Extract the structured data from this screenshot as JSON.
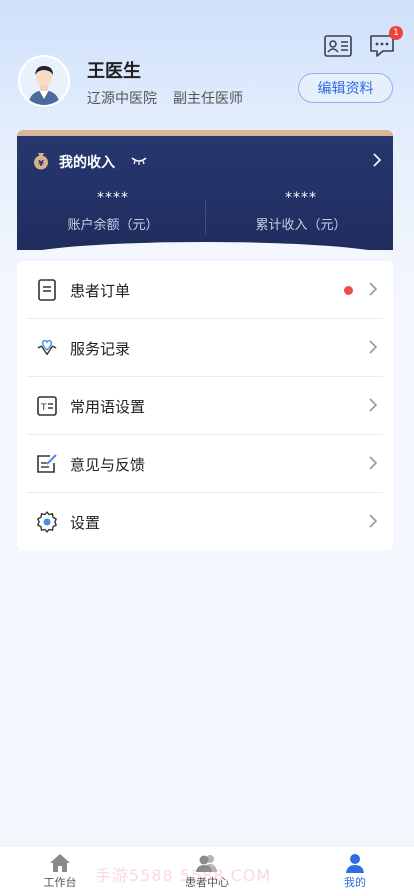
{
  "header": {
    "id_card_icon": "id-card-icon",
    "message_icon": "message-icon",
    "message_badge": "1"
  },
  "profile": {
    "name": "王医生",
    "hospital": "辽源中医院",
    "title": "副主任医师",
    "edit_label": "编辑资料"
  },
  "income": {
    "title": "我的收入",
    "balance_value": "****",
    "balance_label": "账户余额（元）",
    "total_value": "****",
    "total_label": "累计收入（元）"
  },
  "menu": [
    {
      "label": "患者订单",
      "icon": "order-icon",
      "dot": true
    },
    {
      "label": "服务记录",
      "icon": "service-icon",
      "dot": false
    },
    {
      "label": "常用语设置",
      "icon": "phrase-icon",
      "dot": false
    },
    {
      "label": "意见与反馈",
      "icon": "feedback-icon",
      "dot": false
    },
    {
      "label": "设置",
      "icon": "settings-icon",
      "dot": false
    }
  ],
  "tabbar": {
    "tabs": [
      {
        "label": "工作台",
        "icon": "home-icon"
      },
      {
        "label": "患者中心",
        "icon": "patients-icon"
      },
      {
        "label": "我的",
        "icon": "user-icon"
      }
    ],
    "active_index": 2
  },
  "watermark": "手游5588  5588.COM",
  "colors": {
    "accent": "#2d6de0",
    "income_bg": "#1f2c5e",
    "badge": "#f0443b"
  }
}
